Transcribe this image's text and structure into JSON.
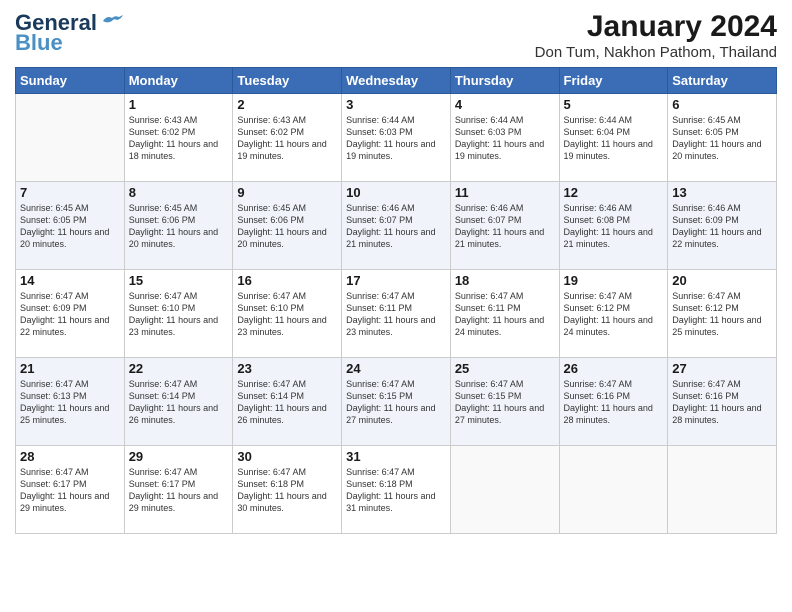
{
  "header": {
    "logo_line1": "General",
    "logo_line2": "Blue",
    "main_title": "January 2024",
    "subtitle": "Don Tum, Nakhon Pathom, Thailand"
  },
  "weekdays": [
    "Sunday",
    "Monday",
    "Tuesday",
    "Wednesday",
    "Thursday",
    "Friday",
    "Saturday"
  ],
  "weeks": [
    [
      null,
      {
        "day": 1,
        "sunrise": "6:43 AM",
        "sunset": "6:02 PM",
        "daylight": "11 hours and 18 minutes."
      },
      {
        "day": 2,
        "sunrise": "6:43 AM",
        "sunset": "6:02 PM",
        "daylight": "11 hours and 19 minutes."
      },
      {
        "day": 3,
        "sunrise": "6:44 AM",
        "sunset": "6:03 PM",
        "daylight": "11 hours and 19 minutes."
      },
      {
        "day": 4,
        "sunrise": "6:44 AM",
        "sunset": "6:03 PM",
        "daylight": "11 hours and 19 minutes."
      },
      {
        "day": 5,
        "sunrise": "6:44 AM",
        "sunset": "6:04 PM",
        "daylight": "11 hours and 19 minutes."
      },
      {
        "day": 6,
        "sunrise": "6:45 AM",
        "sunset": "6:05 PM",
        "daylight": "11 hours and 20 minutes."
      }
    ],
    [
      {
        "day": 7,
        "sunrise": "6:45 AM",
        "sunset": "6:05 PM",
        "daylight": "11 hours and 20 minutes."
      },
      {
        "day": 8,
        "sunrise": "6:45 AM",
        "sunset": "6:06 PM",
        "daylight": "11 hours and 20 minutes."
      },
      {
        "day": 9,
        "sunrise": "6:45 AM",
        "sunset": "6:06 PM",
        "daylight": "11 hours and 20 minutes."
      },
      {
        "day": 10,
        "sunrise": "6:46 AM",
        "sunset": "6:07 PM",
        "daylight": "11 hours and 21 minutes."
      },
      {
        "day": 11,
        "sunrise": "6:46 AM",
        "sunset": "6:07 PM",
        "daylight": "11 hours and 21 minutes."
      },
      {
        "day": 12,
        "sunrise": "6:46 AM",
        "sunset": "6:08 PM",
        "daylight": "11 hours and 21 minutes."
      },
      {
        "day": 13,
        "sunrise": "6:46 AM",
        "sunset": "6:09 PM",
        "daylight": "11 hours and 22 minutes."
      }
    ],
    [
      {
        "day": 14,
        "sunrise": "6:47 AM",
        "sunset": "6:09 PM",
        "daylight": "11 hours and 22 minutes."
      },
      {
        "day": 15,
        "sunrise": "6:47 AM",
        "sunset": "6:10 PM",
        "daylight": "11 hours and 23 minutes."
      },
      {
        "day": 16,
        "sunrise": "6:47 AM",
        "sunset": "6:10 PM",
        "daylight": "11 hours and 23 minutes."
      },
      {
        "day": 17,
        "sunrise": "6:47 AM",
        "sunset": "6:11 PM",
        "daylight": "11 hours and 23 minutes."
      },
      {
        "day": 18,
        "sunrise": "6:47 AM",
        "sunset": "6:11 PM",
        "daylight": "11 hours and 24 minutes."
      },
      {
        "day": 19,
        "sunrise": "6:47 AM",
        "sunset": "6:12 PM",
        "daylight": "11 hours and 24 minutes."
      },
      {
        "day": 20,
        "sunrise": "6:47 AM",
        "sunset": "6:12 PM",
        "daylight": "11 hours and 25 minutes."
      }
    ],
    [
      {
        "day": 21,
        "sunrise": "6:47 AM",
        "sunset": "6:13 PM",
        "daylight": "11 hours and 25 minutes."
      },
      {
        "day": 22,
        "sunrise": "6:47 AM",
        "sunset": "6:14 PM",
        "daylight": "11 hours and 26 minutes."
      },
      {
        "day": 23,
        "sunrise": "6:47 AM",
        "sunset": "6:14 PM",
        "daylight": "11 hours and 26 minutes."
      },
      {
        "day": 24,
        "sunrise": "6:47 AM",
        "sunset": "6:15 PM",
        "daylight": "11 hours and 27 minutes."
      },
      {
        "day": 25,
        "sunrise": "6:47 AM",
        "sunset": "6:15 PM",
        "daylight": "11 hours and 27 minutes."
      },
      {
        "day": 26,
        "sunrise": "6:47 AM",
        "sunset": "6:16 PM",
        "daylight": "11 hours and 28 minutes."
      },
      {
        "day": 27,
        "sunrise": "6:47 AM",
        "sunset": "6:16 PM",
        "daylight": "11 hours and 28 minutes."
      }
    ],
    [
      {
        "day": 28,
        "sunrise": "6:47 AM",
        "sunset": "6:17 PM",
        "daylight": "11 hours and 29 minutes."
      },
      {
        "day": 29,
        "sunrise": "6:47 AM",
        "sunset": "6:17 PM",
        "daylight": "11 hours and 29 minutes."
      },
      {
        "day": 30,
        "sunrise": "6:47 AM",
        "sunset": "6:18 PM",
        "daylight": "11 hours and 30 minutes."
      },
      {
        "day": 31,
        "sunrise": "6:47 AM",
        "sunset": "6:18 PM",
        "daylight": "11 hours and 31 minutes."
      },
      null,
      null,
      null
    ]
  ]
}
